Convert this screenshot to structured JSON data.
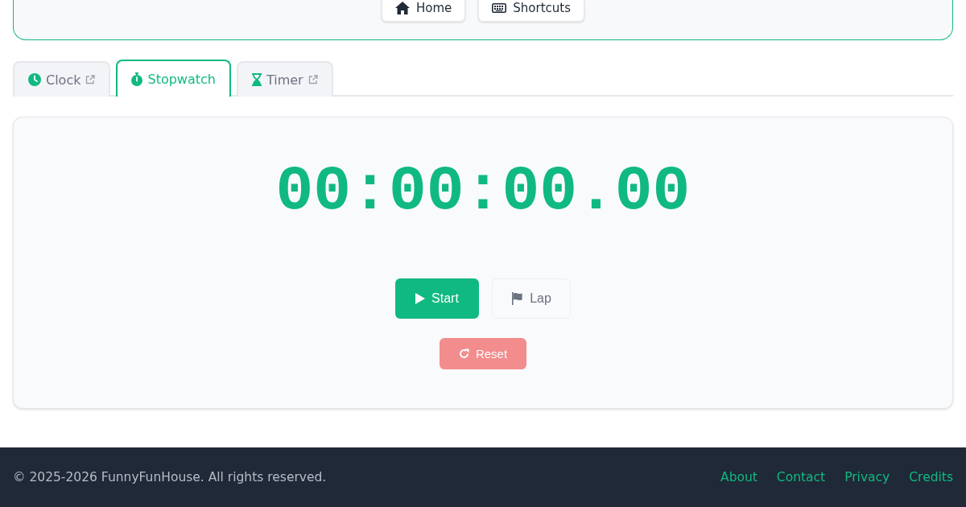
{
  "header": {
    "buttons": [
      {
        "label": "Home",
        "kind": "home"
      },
      {
        "label": "Shortcuts",
        "kind": "keyboard"
      }
    ]
  },
  "tabs": [
    {
      "label": "Clock",
      "kind": "clock",
      "selected": false,
      "external": true
    },
    {
      "label": "Stopwatch",
      "kind": "stopwatch",
      "selected": true,
      "external": false
    },
    {
      "label": "Timer",
      "kind": "hourglass",
      "selected": false,
      "external": true
    }
  ],
  "stopwatch": {
    "display": "00:00:00.00",
    "controls": [
      {
        "label": "Start",
        "kind": "start",
        "disabled": false
      },
      {
        "label": "Lap",
        "kind": "lap",
        "disabled": true
      }
    ],
    "reset": {
      "label": "Reset",
      "kind": "reset",
      "disabled": true
    }
  },
  "footer": {
    "copyright": "© 2025-2026 FunnyFunHouse. All rights reserved.",
    "links": [
      "About",
      "Contact",
      "Privacy",
      "Credits"
    ]
  }
}
